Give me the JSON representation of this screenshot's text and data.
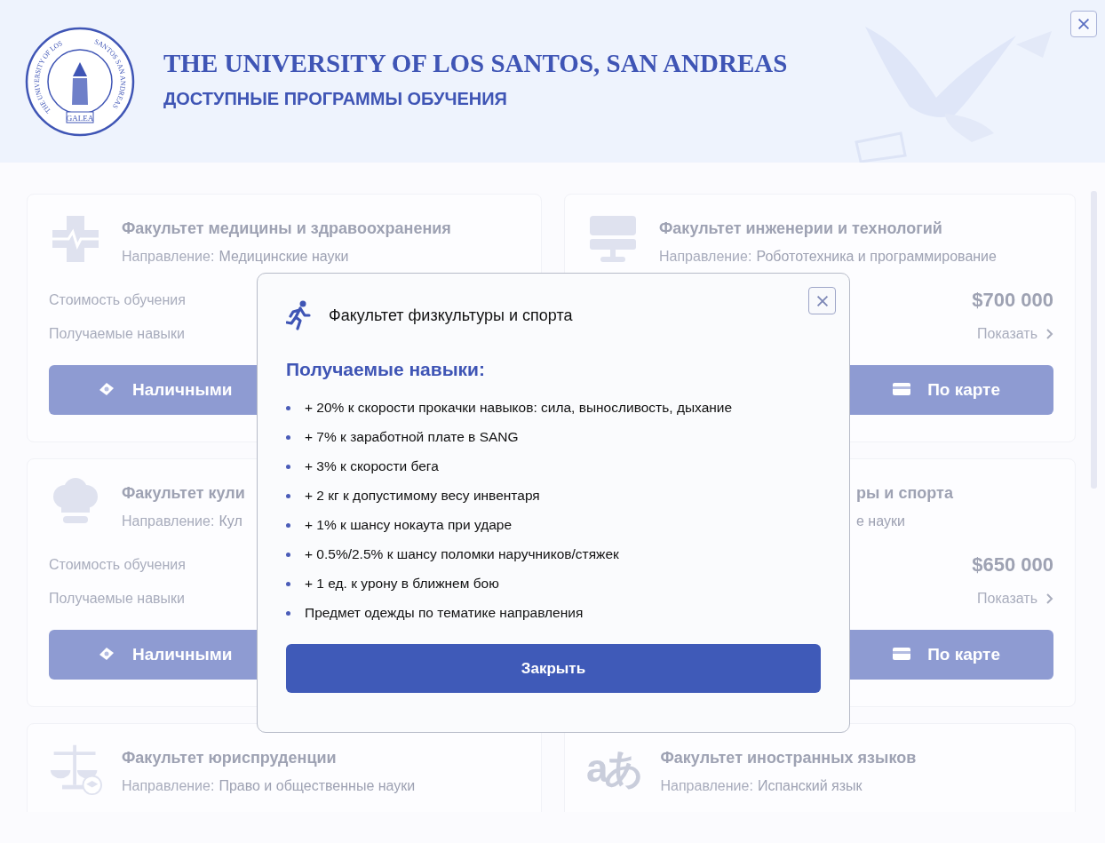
{
  "header": {
    "title": "THE UNIVERSITY OF LOS SANTOS, SAN ANDREAS",
    "subtitle": "ДОСТУПНЫЕ ПРОГРАММЫ ОБУЧЕНИЯ",
    "logo": {
      "ring_texts": [
        "THE UNIVERSITY OF LOS",
        "SANTOS SAN ANDREAS"
      ],
      "banner": "GALEA"
    }
  },
  "cards": [
    {
      "kind": "medical",
      "title": "Факультет медицины и здравоохранения",
      "direction_label": "Направление:",
      "direction": "Медицинские науки",
      "cost_label": "Стоимость обучения",
      "skills_label": "Получаемые навыки",
      "pay_button": {
        "kind": "cash",
        "label": "Наличными"
      }
    },
    {
      "kind": "monitor",
      "title": "Факультет инженерии и технологий",
      "direction_label": "Направление:",
      "direction": "Робототехника и программирование",
      "price": "$700 000",
      "show_link": "Показать",
      "pay_button": {
        "kind": "card",
        "label": "По карте"
      }
    },
    {
      "kind": "chef",
      "title": "Факультет кули",
      "direction_label": "Направление:",
      "direction": "Кул",
      "cost_label": "Стоимость обучения",
      "skills_label": "Получаемые навыки",
      "pay_button": {
        "kind": "cash",
        "label": "Наличными"
      }
    },
    {
      "title": "ры и спорта",
      "direction": "е науки",
      "price": "$650 000",
      "show_link": "Показать",
      "pay_button": {
        "kind": "card",
        "label": "По карте"
      }
    },
    {
      "kind": "law",
      "title": "Факультет юриспруденции",
      "direction_label": "Направление:",
      "direction": "Право и общественные науки"
    },
    {
      "kind": "language",
      "icon_text": "aあ",
      "title": "Факультет иностранных языков",
      "direction_label": "Направление:",
      "direction": "Испанский язык"
    }
  ],
  "modal": {
    "title": "Факультет физкультуры и спорта",
    "heading": "Получаемые навыки:",
    "items": [
      "+ 20% к скорости прокачки навыков: сила, выносливость, дыхание",
      "+ 7% к заработной плате в SANG",
      "+ 3% к скорости бега",
      "+ 2 кг к допустимому весу инвентаря",
      "+ 1% к шансу нокаута при ударе",
      "+ 0.5%/2.5% к шансу поломки наручников/стяжек",
      "+ 1 ед. к урону в ближнем бою",
      "Предмет одежды по тематике направления"
    ],
    "button": "Закрыть"
  }
}
